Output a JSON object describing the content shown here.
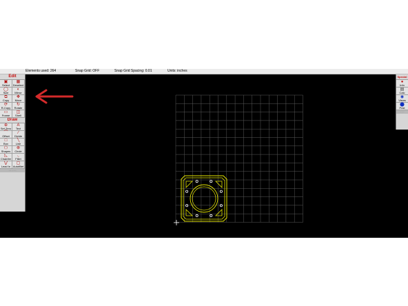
{
  "status": {
    "elements_used": "Elements used: 264",
    "snap_grid": "Snap Grid: OFF",
    "snap_spacing": "Snap Grid Spacing: 0.01",
    "units": "Units: inches"
  },
  "edit_panel": {
    "header": "Edit",
    "tools": [
      "Select",
      "Deselect",
      "Size",
      "Mirror",
      "Copy",
      "Move",
      "R-Copy",
      "Rotate",
      "Frame",
      "Shell"
    ]
  },
  "draw_panel": {
    "header": "Draw",
    "tools": [
      "Set Zero",
      "Text",
      "Offset",
      "Divide",
      "Box",
      "Line",
      "Shapes",
      "Circle",
      "Chamfer",
      "Fillet",
      "Lead In",
      "Autofillet"
    ]
  },
  "special_panel": {
    "header": "Special",
    "tools": [
      "Info",
      "Calc",
      "Views",
      "Post"
    ]
  },
  "colors": {
    "canvas_bg": "#000000",
    "grid": "#5a5a5a",
    "part_outline": "#e6e600",
    "holes": "#ffffff",
    "arrow": "#d42a2a"
  },
  "icons": {
    "arrow": "left-arrow-icon",
    "cursor": "crosshair-icon"
  }
}
